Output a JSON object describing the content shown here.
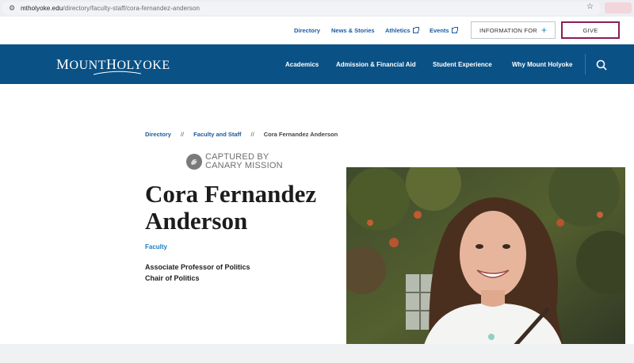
{
  "browser": {
    "url_domain": "mtholyoke.edu",
    "url_path": "/directory/faculty-staff/cora-fernandez-anderson"
  },
  "utility_nav": {
    "directory": "Directory",
    "news": "News & Stories",
    "athletics": "Athletics",
    "events": "Events",
    "information_for": "INFORMATION FOR",
    "give": "GIVE"
  },
  "logo": {
    "m": "M",
    "ount": "OUNT",
    "h": "H",
    "olyoke": "OLYOKE"
  },
  "main_nav": {
    "items": [
      "Academics",
      "Admission & Financial Aid",
      "Student Experience",
      "Why Mount Holyoke"
    ]
  },
  "breadcrumb": {
    "items": [
      "Directory",
      "Faculty and Staff"
    ],
    "separator": "//",
    "current": "Cora Fernandez Anderson"
  },
  "watermark": {
    "line1": "CAPTURED BY",
    "line2": "CANARY MISSION"
  },
  "profile": {
    "name": "Cora Fernandez Anderson",
    "role": "Faculty",
    "titles": [
      "Associate Professor of Politics",
      "Chair of Politics"
    ]
  },
  "colors": {
    "brand_blue": "#0a5186",
    "link_blue": "#1a5b9e",
    "give_border": "#8a1d5a"
  }
}
